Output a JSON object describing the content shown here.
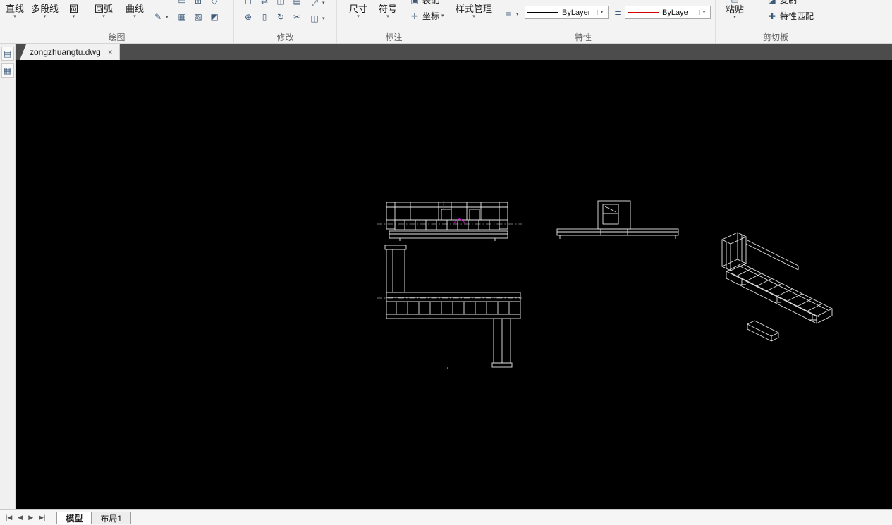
{
  "ribbon": {
    "draw": {
      "label": "绘图",
      "buttons": [
        "直线",
        "多段线",
        "圆",
        "圆弧",
        "曲线"
      ]
    },
    "modify": {
      "label": "修改"
    },
    "annotate": {
      "label": "标注",
      "dimension": "尺寸",
      "symbol": "符号",
      "assembly": "装配",
      "coordinate": "坐标"
    },
    "properties": {
      "label": "特性",
      "style_manager": "样式管理",
      "lineweight_value": "ByLayer",
      "color_value": "ByLayer"
    },
    "clipboard": {
      "label": "剪切板",
      "paste": "粘贴",
      "copy": "复制",
      "match_properties": "特性匹配"
    }
  },
  "document_tab": {
    "title": "zongzhuangtu.dwg",
    "close": "×"
  },
  "sheet_tabs": {
    "model": "模型",
    "layout1": "布局1"
  },
  "colors": {
    "canvas_bg": "#000000",
    "drawing_line": "#e8e8e8",
    "highlight_magenta": "#cc00cc",
    "lineweight_sample": "#000000",
    "color_sample": "#d40000"
  }
}
